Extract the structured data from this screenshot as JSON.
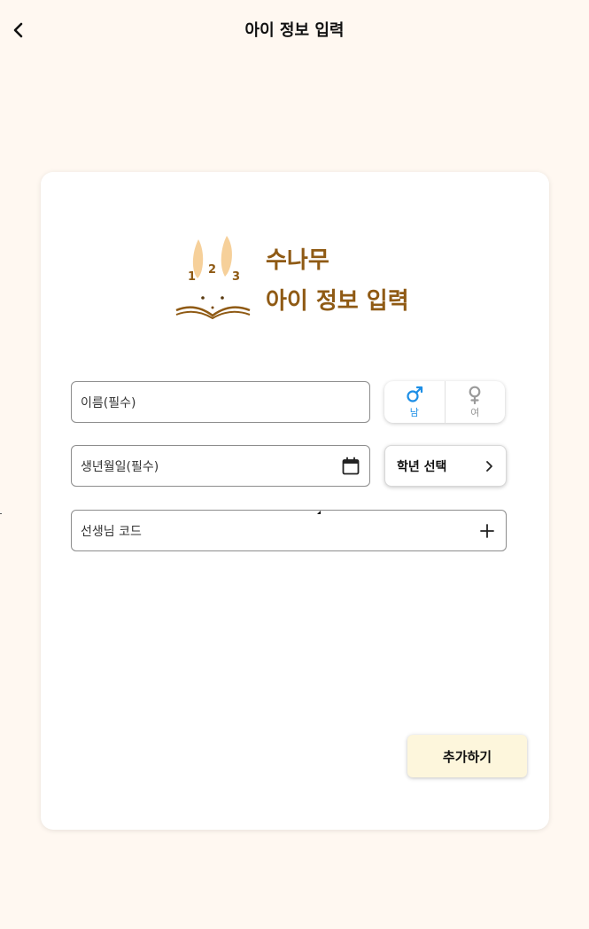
{
  "header": {
    "title": "아이 정보 입력",
    "back_icon": "chevron-left-icon"
  },
  "logo": {
    "brand_line": "수나무",
    "subtitle_line": "아이 정보 입력",
    "ear_numbers": [
      "1",
      "2",
      "3"
    ]
  },
  "form": {
    "name_placeholder": "이름(필수)",
    "birth_placeholder": "생년월일(필수)",
    "teacher_placeholder": "선생님 코드",
    "gender": {
      "male_label": "남",
      "female_label": "여",
      "selected": "male"
    },
    "grade_label": "학년 선택"
  },
  "actions": {
    "add_label": "추가하기"
  },
  "colors": {
    "background": "#fff8f1",
    "accent_blue": "#1c8ee6",
    "logo_brown": "#8f5a14",
    "add_button_bg": "#fdf6dc"
  }
}
